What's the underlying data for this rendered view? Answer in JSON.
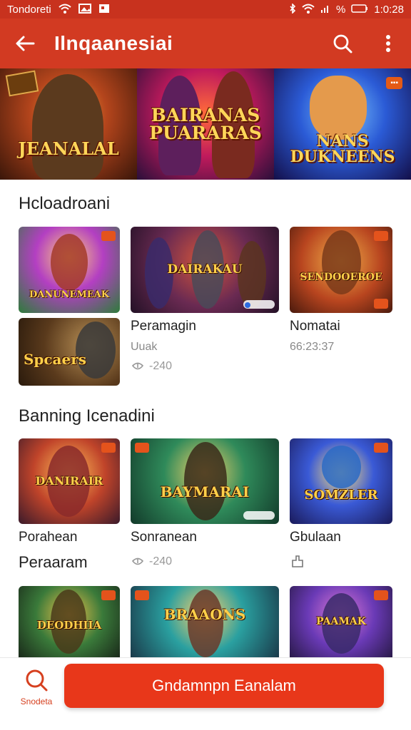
{
  "status_bar": {
    "carrier": "Tondoreti",
    "battery": "%",
    "time": "1:0:28"
  },
  "app_bar": {
    "title": "Ilnqaanesiai",
    "icons": [
      "back-arrow-icon",
      "search-icon",
      "more-vertical-icon"
    ]
  },
  "hero": {
    "panels": [
      {
        "title": "JEANALAL"
      },
      {
        "title": "BAIRANAS PUARARAS"
      },
      {
        "title": "NANS DUKNEENS"
      }
    ]
  },
  "section1": {
    "title": "Hcloadroani",
    "tiles": [
      {
        "art": "DANUNEMEAK"
      },
      {
        "art": "DAIRAKAU"
      },
      {
        "art": "SENDOOEROE"
      },
      {
        "art": "Spcaers"
      }
    ],
    "items": [
      {
        "name": "Peramagin",
        "sub": "Uuak",
        "meta": "-240"
      },
      {
        "name": "Nomatai",
        "sub": "66:23:37"
      }
    ]
  },
  "section2": {
    "title": "Banning Icenadini",
    "tiles": [
      {
        "art": "DANIRAIR"
      },
      {
        "art": "BAYMARAI"
      },
      {
        "art": "SOMZLER"
      }
    ],
    "items": [
      {
        "name": "Porahean"
      },
      {
        "name": "Sonranean",
        "meta": "-240"
      },
      {
        "name": "Gbulaan"
      }
    ],
    "extra_label": "Peraaram"
  },
  "section3": {
    "tiles": [
      {
        "art": "DEODHIIA"
      },
      {
        "art": "BRAAONS"
      },
      {
        "art": "PAAMAK"
      }
    ]
  },
  "bottom": {
    "nav_label": "Snodeta",
    "cta_label": "Gndamnpn Eanalam"
  },
  "colors": {
    "primary": "#d23a22",
    "status_bar": "#c8321e",
    "cta": "#e8371a"
  }
}
